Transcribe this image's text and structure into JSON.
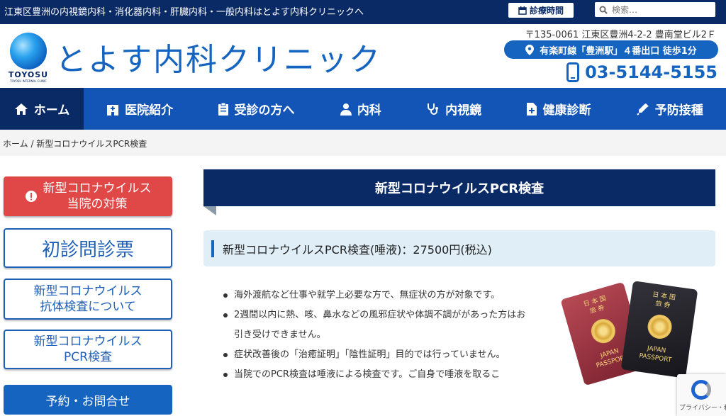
{
  "topbar": {
    "tagline": "江東区豊洲の内視鏡内科・消化器内科・肝臓内科・一般内科はとよす内科クリニックへ",
    "hours_label": "診療時間",
    "search_placeholder": "検索…"
  },
  "header": {
    "logo_word": "TOYOSU",
    "logo_sub": "TOYOSU INTERNAL CLINIC",
    "clinic_name": "とよす内科クリニック",
    "address": "〒135-0061 江東区豊洲4-2-2 豊南堂ビル2Ｆ",
    "access": "有楽町線「豊洲駅」４番出口 徒歩1分",
    "phone": "03-5144-5155"
  },
  "nav": {
    "items": [
      {
        "label": "ホーム",
        "icon": "home-icon"
      },
      {
        "label": "医院紹介",
        "icon": "hospital-icon"
      },
      {
        "label": "受診の方へ",
        "icon": "clipboard-icon"
      },
      {
        "label": "内科",
        "icon": "doctor-icon"
      },
      {
        "label": "内視鏡",
        "icon": "stethoscope-icon"
      },
      {
        "label": "健康診断",
        "icon": "medical-file-icon"
      },
      {
        "label": "予防接種",
        "icon": "syringe-icon"
      }
    ]
  },
  "breadcrumb": "ホーム / 新型コロナウイルスPCR検査",
  "sidebar": {
    "covid_measures": [
      "新型コロナウイルス",
      "当院の対策"
    ],
    "questionnaire": "初診問診票",
    "antibody": [
      "新型コロナウイルス",
      "抗体検査について"
    ],
    "pcr": [
      "新型コロナウイルス",
      "PCR検査"
    ],
    "contact": "予約・お問合せ"
  },
  "main": {
    "title": "新型コロナウイルスPCR検査",
    "price_heading": "新型コロナウイルスPCR検査(唾液)：27500円(税込)",
    "bullets": [
      "海外渡航など仕事や就学上必要な方で、無症状の方が対象です。",
      "2週間以内に熱、咳、鼻水などの風邪症状や体調不調ががあった方はお引き受けできません。",
      "症状改善後の「治癒証明」「陰性証明」目的では行っていません。",
      "当院でのPCR検査は唾液による検査です。ご自身で唾液を取るこ"
    ],
    "passport_red": [
      "日 本 国",
      "旅 券",
      "JAPAN",
      "PASSPORT"
    ],
    "passport_dark": [
      "日 本 国",
      "旅 券",
      "JAPAN",
      "PASSPORT"
    ]
  },
  "recaptcha": "プライバシー・利用規約",
  "colors": {
    "navy": "#0a2a66",
    "blue": "#1565c0",
    "red": "#e04848"
  }
}
